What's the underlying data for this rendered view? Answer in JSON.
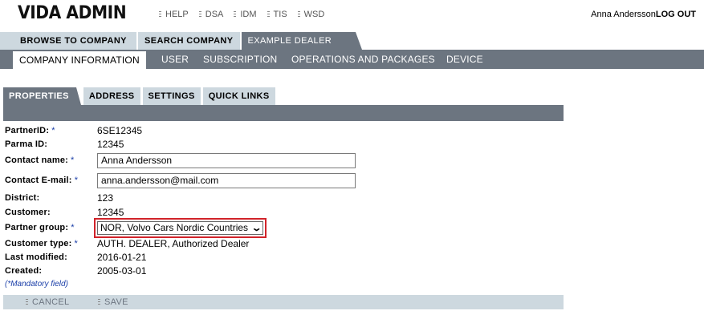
{
  "app": {
    "title": "VIDA ADMIN"
  },
  "toplinks": [
    "HELP",
    "DSA",
    "IDM",
    "TIS",
    "WSD"
  ],
  "user": {
    "name": "Anna Andersson",
    "logout": "LOG OUT"
  },
  "tabs": [
    "BROWSE TO COMPANY",
    "SEARCH COMPANY",
    "EXAMPLE DEALER"
  ],
  "subnav": [
    "COMPANY INFORMATION",
    "USER",
    "SUBSCRIPTION",
    "OPERATIONS AND PACKAGES",
    "DEVICE"
  ],
  "property_tabs": [
    "PROPERTIES",
    "ADDRESS",
    "SETTINGS",
    "QUICK LINKS"
  ],
  "form": {
    "partner_id": {
      "label": "PartnerID:",
      "value": "6SE12345"
    },
    "parma_id": {
      "label": "Parma ID:",
      "value": "12345"
    },
    "contact_name": {
      "label": "Contact name:",
      "value": "Anna Andersson"
    },
    "contact_email": {
      "label": "Contact E-mail:",
      "value": "anna.andersson@mail.com"
    },
    "district": {
      "label": "District:",
      "value": "123"
    },
    "customer": {
      "label": "Customer:",
      "value": "12345"
    },
    "partner_group": {
      "label": "Partner group:",
      "value": "NOR, Volvo Cars Nordic Countries"
    },
    "customer_type": {
      "label": "Customer type:",
      "value": "AUTH. DEALER, Authorized Dealer"
    },
    "last_modified": {
      "label": "Last modified:",
      "value": "2016-01-21"
    },
    "created": {
      "label": "Created:",
      "value": "2005-03-01"
    },
    "mandatory_star": "*",
    "mandatory_note": "(*Mandatory field)"
  },
  "actions": {
    "cancel": "CANCEL",
    "save": "SAVE"
  },
  "colors": {
    "tab_dark": "#6c7580",
    "tab_light": "#cdd8df",
    "highlight": "#d1232a",
    "mandatory": "#1a3ea8"
  }
}
